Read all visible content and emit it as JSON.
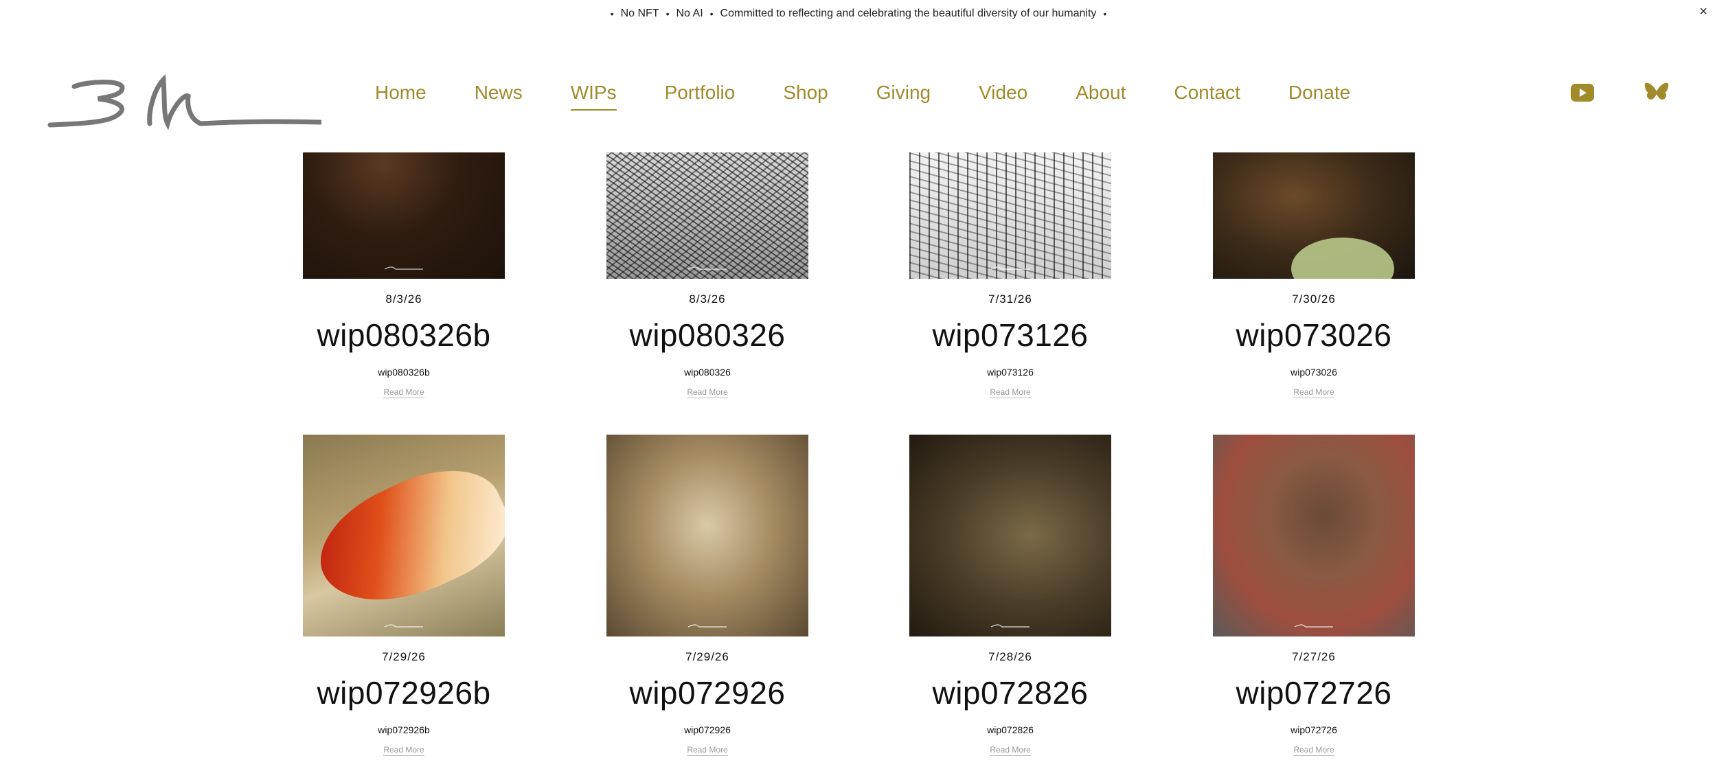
{
  "announcement": {
    "items": [
      "No NFT",
      "No AI",
      "Committed to reflecting and celebrating the beautiful diversity of our humanity"
    ],
    "close_label": "×"
  },
  "nav": {
    "items": [
      {
        "label": "Home"
      },
      {
        "label": "News"
      },
      {
        "label": "WIPs",
        "active": true
      },
      {
        "label": "Portfolio"
      },
      {
        "label": "Shop"
      },
      {
        "label": "Giving"
      },
      {
        "label": "Video"
      },
      {
        "label": "About"
      },
      {
        "label": "Contact"
      },
      {
        "label": "Donate"
      }
    ],
    "social": [
      "youtube-icon",
      "bluesky-icon"
    ]
  },
  "colors": {
    "accent": "#a08a2a",
    "text": "#111111",
    "muted": "#999999"
  },
  "posts": [
    {
      "date": "8/3/26",
      "title": "wip080326b",
      "caption": "wip080326b",
      "read_more": "Read More"
    },
    {
      "date": "8/3/26",
      "title": "wip080326",
      "caption": "wip080326",
      "read_more": "Read More"
    },
    {
      "date": "7/31/26",
      "title": "wip073126",
      "caption": "wip073126",
      "read_more": "Read More"
    },
    {
      "date": "7/30/26",
      "title": "wip073026",
      "caption": "wip073026",
      "read_more": "Read More"
    },
    {
      "date": "7/29/26",
      "title": "wip072926b",
      "caption": "wip072926b",
      "read_more": "Read More"
    },
    {
      "date": "7/29/26",
      "title": "wip072926",
      "caption": "wip072926",
      "read_more": "Read More"
    },
    {
      "date": "7/28/26",
      "title": "wip072826",
      "caption": "wip072826",
      "read_more": "Read More"
    },
    {
      "date": "7/27/26",
      "title": "wip072726",
      "caption": "wip072726",
      "read_more": "Read More"
    }
  ]
}
